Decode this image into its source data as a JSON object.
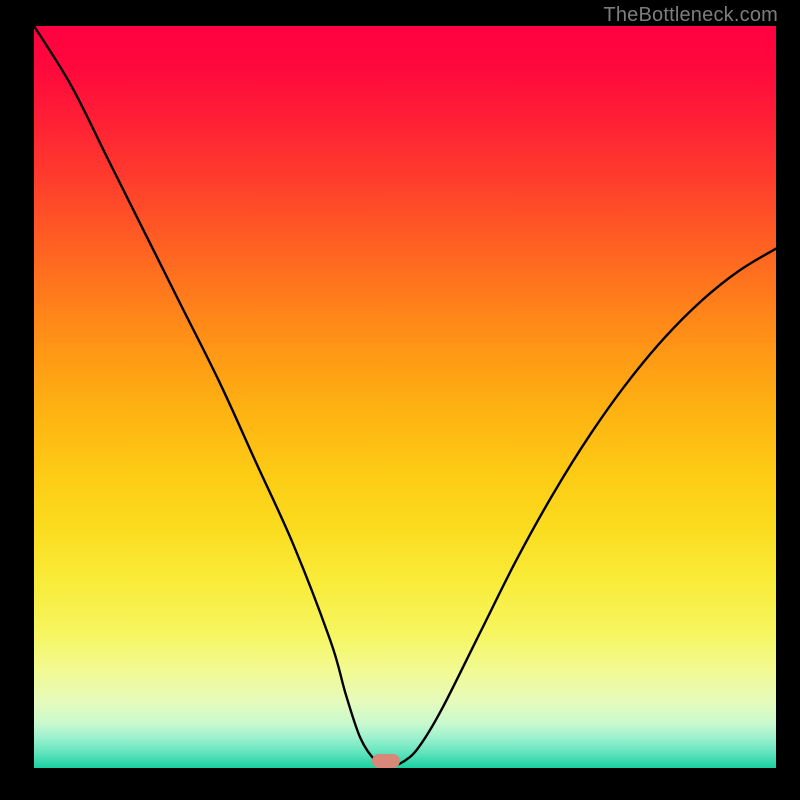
{
  "attribution": "TheBottleneck.com",
  "marker": {
    "x_pct": 47.5,
    "y_pct": 99.0
  },
  "chart_data": {
    "type": "line",
    "title": "",
    "xlabel": "",
    "ylabel": "",
    "xlim": [
      0,
      100
    ],
    "ylim": [
      0,
      100
    ],
    "grid": false,
    "legend": false,
    "background": "red-yellow-green vertical gradient (high=bad, low=good)",
    "series": [
      {
        "name": "bottleneck-curve",
        "x": [
          0,
          5,
          10,
          15,
          20,
          25,
          30,
          35,
          40,
          42,
          44,
          46,
          47.5,
          50,
          52,
          55,
          60,
          65,
          70,
          75,
          80,
          85,
          90,
          95,
          100
        ],
        "y": [
          100,
          92,
          82,
          72,
          62,
          52,
          41,
          30,
          17,
          10,
          4,
          1,
          0,
          1,
          3,
          8,
          18,
          28,
          37,
          45,
          52,
          58,
          63,
          67,
          70
        ]
      }
    ],
    "annotations": [
      {
        "type": "marker",
        "x": 47.5,
        "y": 0,
        "shape": "pill",
        "color": "#d88878"
      }
    ]
  }
}
